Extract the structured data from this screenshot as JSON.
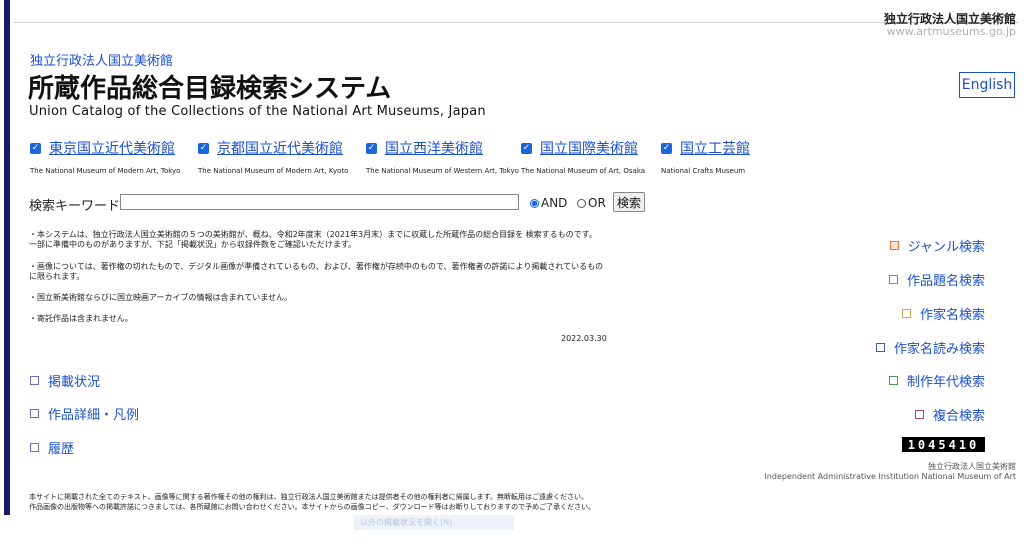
{
  "brand": {
    "name_jp": "独立行政法人国立美術館",
    "url": "www.artmuseums.go.jp"
  },
  "header": {
    "org_link": "独立行政法人国立美術館",
    "title": "所蔵作品総合目録検索システム",
    "subtitle": "Union Catalog of the Collections of the National Art Museums, Japan",
    "english_button": "English"
  },
  "museums": [
    {
      "label": "東京国立近代美術館",
      "en": "The National Museum of Modern Art, Tokyo",
      "checked": true
    },
    {
      "label": "京都国立近代美術館",
      "en": "The National Museum of Modern Art, Kyoto",
      "checked": true
    },
    {
      "label": "国立西洋美術館",
      "en": "The National Museum of Western Art, Tokyo",
      "checked": true
    },
    {
      "label": "国立国際美術館",
      "en": "The National Museum of Art, Osaka",
      "checked": true
    },
    {
      "label": "国立工芸館",
      "en": "National Crafts Museum",
      "checked": true
    }
  ],
  "search": {
    "label": "検索キーワード:",
    "value": "",
    "placeholder": "",
    "and_label": "AND",
    "or_label": "OR",
    "selected_mode": "AND",
    "button": "検索"
  },
  "notices": [
    "・本システムは、独立行政法人国立美術館の５つの美術館が、概ね、令和2年度末（2021年3月末）までに収蔵した所蔵作品の総合目録を 検索するものです。一部に準備中のものがありますが、下記「掲載状況」から収録件数をご確認いただけます。",
    "・画像については、著作権の切れたもので、デジタル画像が準備されているもの、および、著作権が存続中のもので、著作権者の許諾により掲載されているものに限られます。",
    "・国立新美術館ならびに国立映画アーカイブの情報は含まれていません。",
    "・寄託作品は含まれません。"
  ],
  "date": "2022.03.30",
  "left_nav": [
    {
      "label": "掲載状況",
      "color": "#6a6fc0"
    },
    {
      "label": "作品詳細・凡例",
      "color": "#6a6fc0"
    },
    {
      "label": "履歴",
      "color": "#6a6fc0"
    }
  ],
  "right_nav": [
    {
      "label": "ジャンル検索",
      "color": "#e07a3c",
      "fill": "#fbe3d3"
    },
    {
      "label": "作品題名検索",
      "color": "#d0606a",
      "fill": "#ffffff"
    },
    {
      "label": "作家名検索",
      "color": "#c9b04a",
      "fill": "#ffffff"
    },
    {
      "label": "作家名読み検索",
      "color": "#3f5fa8",
      "fill": "#ffffff"
    },
    {
      "label": "制作年代検索",
      "color": "#4e9a4e",
      "fill": "#ffffff"
    },
    {
      "label": "複合検索",
      "color": "#a04a7a",
      "fill": "#ffffff"
    }
  ],
  "counter": "1045410",
  "credit": {
    "jp": "独立行政法人国立美術館",
    "en": "Independent Administrative Institution National Museum of Art"
  },
  "footer": {
    "line1": "本サイトに掲載された全てのテキスト、画像等に関する著作権その他の権利は、独立行政法人国立美術館または提供者その他の権利者に帰属します。無断転用はご遠慮ください。",
    "line2": "作品画像の出版物等への掲載許諾につきましては、各所蔵館にお問い合わせください。本サイトからの画像コピー、ダウンロード等はお断りしておりますので予めご了承ください。"
  },
  "faded_bar": "以外の掲載状況を開く(N)"
}
